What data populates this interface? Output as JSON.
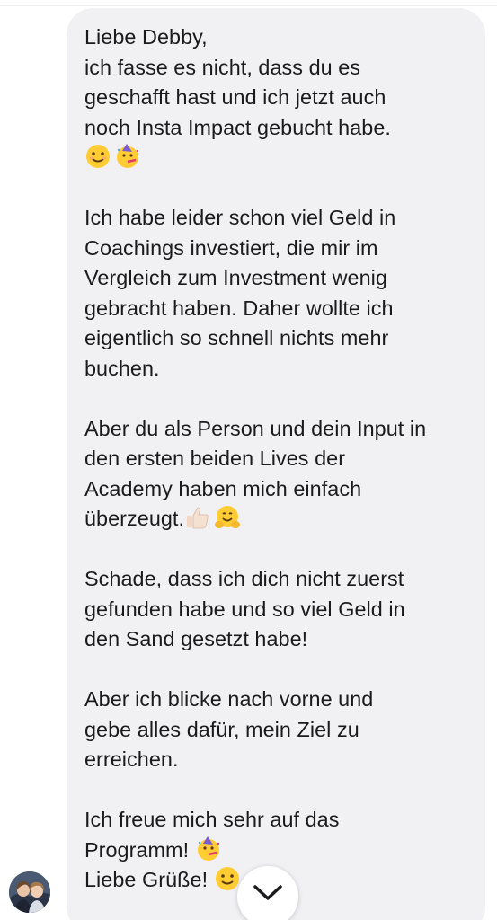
{
  "message": {
    "lines": [
      "Liebe Debby,",
      "ich fasse es nicht, dass du es",
      "geschafft hast und ich jetzt auch",
      "noch Insta Impact gebucht habe.",
      "",
      "",
      "Ich habe leider schon viel Geld in",
      "Coachings investiert, die mir im",
      "Vergleich zum Investment wenig",
      "gebracht haben. Daher wollte ich",
      "eigentlich so schnell nichts mehr",
      "buchen.",
      "",
      "Aber du als Person und dein Input in",
      "den ersten beiden Lives der",
      "Academy haben mich einfach",
      "überzeugt.",
      "",
      "Schade, dass ich dich nicht zuerst",
      "gefunden habe und so viel Geld in",
      "den Sand gesetzt habe!",
      "",
      "Aber ich blicke nach vorne und",
      "gebe alles dafür, mein Ziel zu",
      "erreichen.",
      "",
      "Ich freue mich sehr auf das",
      "Programm!",
      "Liebe Grüße!"
    ],
    "emojis": {
      "line5": [
        "smiling-face-icon",
        "partying-face-icon"
      ],
      "line17": [
        "thumbs-up-icon",
        "hugging-face-icon"
      ],
      "line28": [
        "partying-face-icon"
      ],
      "line29": [
        "smiling-face-icon"
      ]
    }
  },
  "colors": {
    "bubble": "#f1f1f4",
    "text": "#1b1b1d",
    "background": "#ffffff"
  },
  "scroll_button": {
    "icon": "chevron-down-icon"
  }
}
